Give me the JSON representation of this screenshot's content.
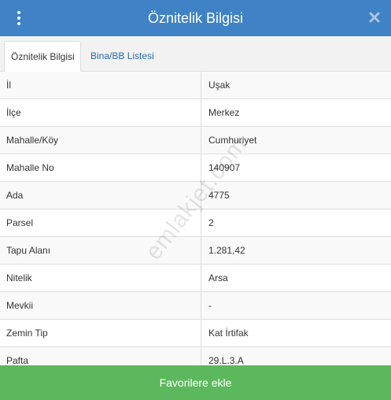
{
  "header": {
    "title": "Öznitelik Bilgisi",
    "menu_icon": "vertical-ellipsis-icon",
    "close_icon": "close-icon",
    "background": "#3f82c6"
  },
  "tabs": [
    {
      "label": "Öznitelik Bilgisi",
      "active": true
    },
    {
      "label": "Bina/BB Listesi",
      "active": false
    }
  ],
  "attributes": [
    {
      "label": "İl",
      "value": "Uşak"
    },
    {
      "label": "İlçe",
      "value": "Merkez"
    },
    {
      "label": "Mahalle/Köy",
      "value": "Cumhuriyet"
    },
    {
      "label": "Mahalle No",
      "value": "140907"
    },
    {
      "label": "Ada",
      "value": "4775"
    },
    {
      "label": "Parsel",
      "value": "2"
    },
    {
      "label": "Tapu Alanı",
      "value": "1.281,42"
    },
    {
      "label": "Nitelik",
      "value": "Arsa"
    },
    {
      "label": "Mevkii",
      "value": "-"
    },
    {
      "label": "Zemin Tip",
      "value": "Kat İrtifak"
    },
    {
      "label": "Pafta",
      "value": "29.L.3.A"
    }
  ],
  "watermark": "emlakjet.com",
  "footer": {
    "button_label": "Favorilere ekle",
    "color": "#5cb85c"
  }
}
